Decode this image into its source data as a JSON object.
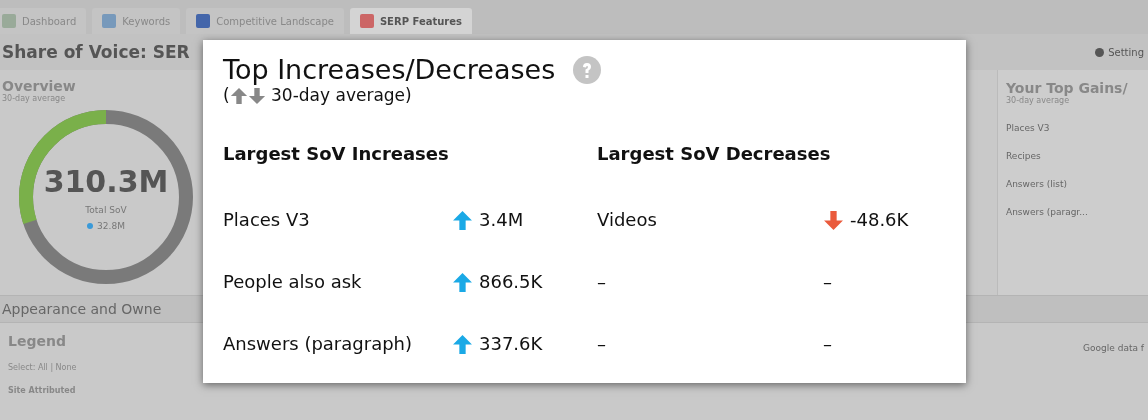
{
  "background": {
    "tabs": [
      {
        "label": "Dashboard",
        "selected": false
      },
      {
        "label": "Keywords",
        "selected": false
      },
      {
        "label": "Competitive Landscape",
        "selected": false
      },
      {
        "label": "SERP Features",
        "selected": true
      }
    ],
    "page_title": "Share of Voice: SER",
    "settings": "Setting",
    "overview": {
      "title": "Overview",
      "subtitle": "30-day average",
      "total": "310.3M",
      "total_label": "Total SoV",
      "change": "32.8M",
      "level": 0.3
    },
    "top_gains": {
      "title": "Your Top Gains/",
      "subtitle": "30-day average",
      "items": [
        "Places V3",
        "Recipes",
        "Answers (list)",
        "Answers (paragr..."
      ]
    },
    "section_title": "Appearance and Owne",
    "legend": {
      "title": "Legend",
      "select": "Select: All | None",
      "group": "Site Attributed"
    },
    "note": "Google data f"
  },
  "popup": {
    "title": "Top Increases/Decreases",
    "subtitle_open": "(",
    "subtitle": "30-day average)",
    "columns": [
      {
        "heading": "Largest SoV Increases",
        "rows": [
          {
            "name": "Places V3",
            "value": "3.4M",
            "kind": "up"
          },
          {
            "name": "People also ask",
            "value": "866.5K",
            "kind": "up"
          },
          {
            "name": "Answers (paragraph)",
            "value": "337.6K",
            "kind": "up"
          }
        ]
      },
      {
        "heading": "Largest SoV Decreases",
        "rows": [
          {
            "name": "Videos",
            "value": "-48.6K",
            "kind": "down"
          },
          {
            "name": "–",
            "value": "–",
            "kind": "none"
          },
          {
            "name": "–",
            "value": "–",
            "kind": "none"
          }
        ]
      }
    ]
  }
}
